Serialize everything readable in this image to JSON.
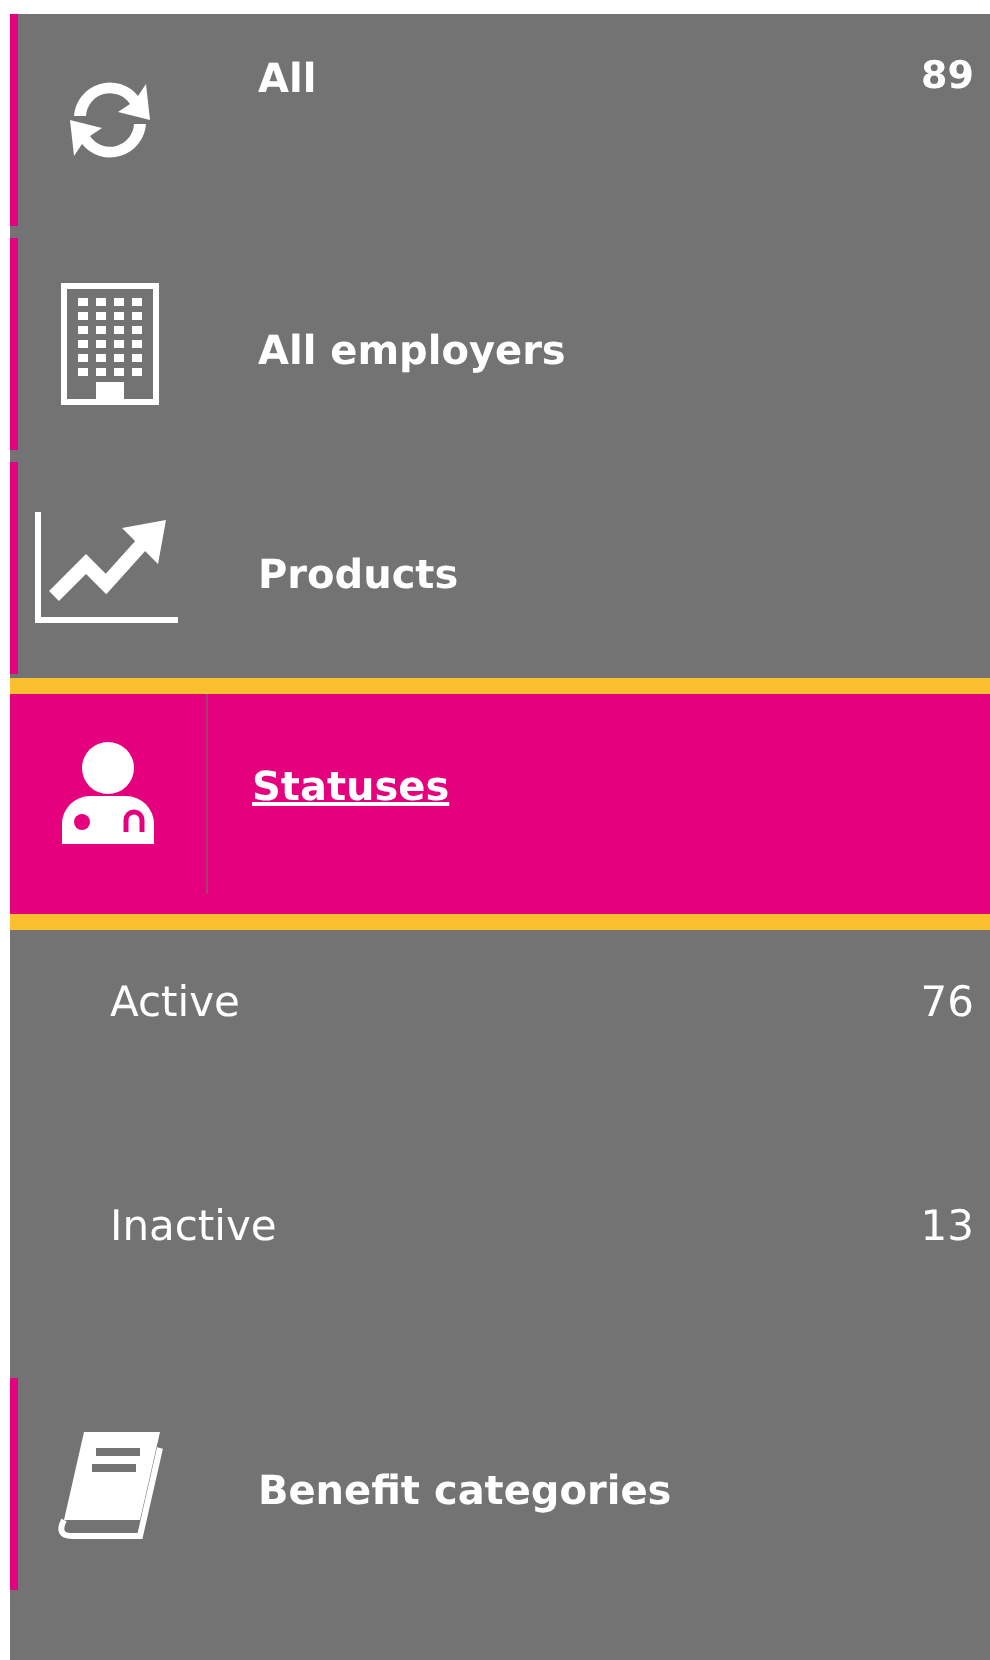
{
  "menu": [
    {
      "label": "All",
      "count": "89",
      "selected": false
    },
    {
      "label": "All employers",
      "selected": false
    },
    {
      "label": "Products",
      "selected": false
    },
    {
      "label": "Statuses",
      "selected": true,
      "expanded": true,
      "children": [
        {
          "label": "Active",
          "count": "76"
        },
        {
          "label": "Inactive",
          "count": "13"
        }
      ]
    },
    {
      "label": "Benefit categories",
      "selected": false
    }
  ]
}
